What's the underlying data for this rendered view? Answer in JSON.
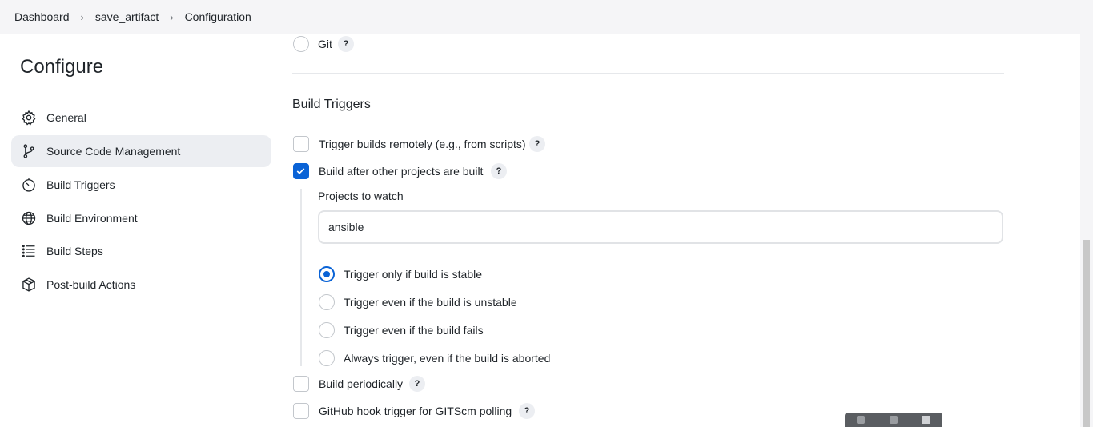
{
  "breadcrumb": {
    "items": [
      "Dashboard",
      "save_artifact",
      "Configuration"
    ]
  },
  "sidebar": {
    "title": "Configure",
    "items": [
      {
        "label": "General",
        "icon": "gear-icon"
      },
      {
        "label": "Source Code Management",
        "icon": "branch-icon",
        "active": true
      },
      {
        "label": "Build Triggers",
        "icon": "clock-icon"
      },
      {
        "label": "Build Environment",
        "icon": "globe-icon"
      },
      {
        "label": "Build Steps",
        "icon": "list-icon"
      },
      {
        "label": "Post-build Actions",
        "icon": "package-icon"
      }
    ]
  },
  "scm": {
    "git_label": "Git",
    "git_selected": false
  },
  "build_triggers": {
    "title": "Build Triggers",
    "remote": {
      "label": "Trigger builds remotely (e.g., from scripts)",
      "checked": false
    },
    "after_other": {
      "label": "Build after other projects are built",
      "checked": true
    },
    "projects_label": "Projects to watch",
    "projects_value": "ansible",
    "options": [
      {
        "label": "Trigger only if build is stable",
        "selected": true
      },
      {
        "label": "Trigger even if the build is unstable",
        "selected": false
      },
      {
        "label": "Trigger even if the build fails",
        "selected": false
      },
      {
        "label": "Always trigger, even if the build is aborted",
        "selected": false
      }
    ],
    "periodic": {
      "label": "Build periodically",
      "checked": false
    },
    "github": {
      "label": "GitHub hook trigger for GITScm polling",
      "checked": false
    }
  },
  "help_label": "?",
  "colors": {
    "accent": "#0a63d6",
    "active_bg": "#eceef2",
    "topbar_bg": "#f5f5f7"
  }
}
